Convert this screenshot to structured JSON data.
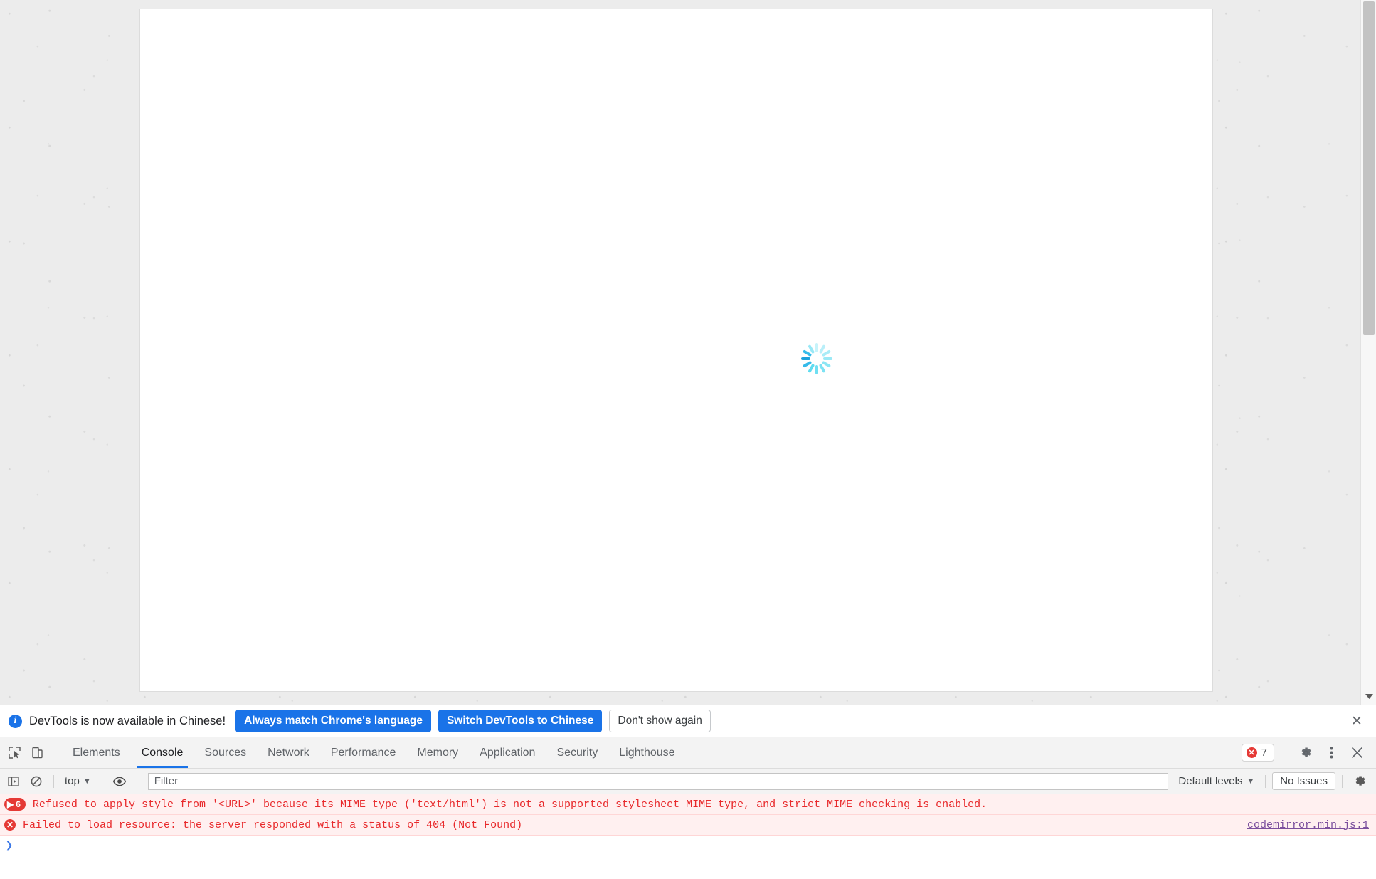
{
  "page": {
    "loading_spinner": "loading-spinner",
    "spinner_color": "#46d6ee",
    "background_color": "#ececec",
    "panel_color": "#ffffff"
  },
  "scrollbar": {
    "name": "vertical-scrollbar",
    "down_arrow_icon": "chevron-down-icon"
  },
  "infobar": {
    "icon": "info-icon",
    "message": "DevTools is now available in Chinese!",
    "buttons": [
      {
        "label": "Always match Chrome's language",
        "style": "primary"
      },
      {
        "label": "Switch DevTools to Chinese",
        "style": "primary"
      },
      {
        "label": "Don't show again",
        "style": "secondary"
      }
    ],
    "close_label": "✕",
    "accent_color": "#1a73e8"
  },
  "tabbar": {
    "inspect_icon": "inspect-element-icon",
    "device_icon": "device-toolbar-icon",
    "tabs": [
      {
        "label": "Elements",
        "active": false
      },
      {
        "label": "Console",
        "active": true
      },
      {
        "label": "Sources",
        "active": false
      },
      {
        "label": "Network",
        "active": false
      },
      {
        "label": "Performance",
        "active": false
      },
      {
        "label": "Memory",
        "active": false
      },
      {
        "label": "Application",
        "active": false
      },
      {
        "label": "Security",
        "active": false
      },
      {
        "label": "Lighthouse",
        "active": false
      }
    ],
    "error_badge": {
      "icon": "error-icon",
      "count": "7"
    },
    "settings_icon": "gear-icon",
    "more_icon": "three-dot-menu-icon",
    "close_icon": "close-icon",
    "active_underline_color": "#1a73e8"
  },
  "console_toolbar": {
    "sidebar_toggle_icon": "console-sidebar-icon",
    "clear_icon": "clear-console-icon",
    "context": "top",
    "context_caret": "▼",
    "eye_icon": "live-expression-icon",
    "filter_placeholder": "Filter",
    "filter_value": "",
    "levels_label": "Default levels",
    "levels_caret": "▼",
    "issues_label": "No Issues",
    "settings_icon": "gear-icon"
  },
  "console_messages": [
    {
      "kind": "error-group",
      "badge_count": "6",
      "badge_caret": "▶",
      "text": "Refused to apply style from '<URL>' because its MIME type ('text/html') is not a supported stylesheet MIME type, and strict MIME checking is enabled.",
      "source": ""
    },
    {
      "kind": "error",
      "badge_count": "",
      "badge_caret": "",
      "text": "Failed to load resource: the server responded with a status of 404 (Not Found)",
      "source": "codemirror.min.js:1"
    }
  ],
  "console_prompt": {
    "caret": "❯",
    "value": "",
    "placeholder": ""
  }
}
